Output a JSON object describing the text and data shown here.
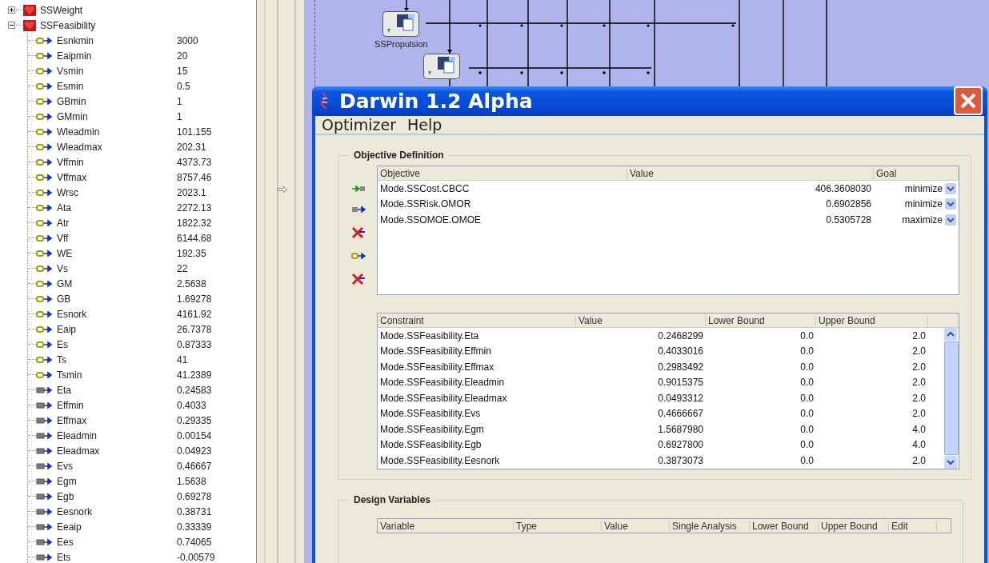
{
  "tree": [
    {
      "label": "SSWeight",
      "expanded": false
    },
    {
      "label": "SSFeasibility",
      "expanded": true,
      "children": [
        {
          "kind": "input",
          "name": "Esnkmin",
          "value": "3000"
        },
        {
          "kind": "input",
          "name": "Eaipmin",
          "value": "20"
        },
        {
          "kind": "input",
          "name": "Vsmin",
          "value": "15"
        },
        {
          "kind": "input",
          "name": "Esmin",
          "value": "0.5"
        },
        {
          "kind": "input",
          "name": "GBmin",
          "value": "1"
        },
        {
          "kind": "input",
          "name": "GMmin",
          "value": "1"
        },
        {
          "kind": "input",
          "name": "Wleadmin",
          "value": "101.155"
        },
        {
          "kind": "input",
          "name": "Wleadmax",
          "value": "202.31"
        },
        {
          "kind": "input",
          "name": "Vffmin",
          "value": "4373.73"
        },
        {
          "kind": "input",
          "name": "Vffmax",
          "value": "8757.46"
        },
        {
          "kind": "input",
          "name": "Wrsc",
          "value": "2023.1"
        },
        {
          "kind": "input",
          "name": "Ata",
          "value": "2272.13"
        },
        {
          "kind": "input",
          "name": "Atr",
          "value": "1822.32"
        },
        {
          "kind": "input",
          "name": "Vff",
          "value": "6144.68"
        },
        {
          "kind": "input",
          "name": "WE",
          "value": "192.35"
        },
        {
          "kind": "input",
          "name": "Vs",
          "value": "22"
        },
        {
          "kind": "input",
          "name": "GM",
          "value": "2.5638"
        },
        {
          "kind": "input",
          "name": "GB",
          "value": "1.69278"
        },
        {
          "kind": "input",
          "name": "Esnork",
          "value": "4161.92"
        },
        {
          "kind": "input",
          "name": "Eaip",
          "value": "26.7378"
        },
        {
          "kind": "input",
          "name": "Es",
          "value": "0.87333"
        },
        {
          "kind": "input",
          "name": "Ts",
          "value": "41"
        },
        {
          "kind": "input",
          "name": "Tsmin",
          "value": "41.2389"
        },
        {
          "kind": "output",
          "name": "Eta",
          "value": "0.24583"
        },
        {
          "kind": "output",
          "name": "Effmin",
          "value": "0.4033"
        },
        {
          "kind": "output",
          "name": "Effmax",
          "value": "0.29335"
        },
        {
          "kind": "output",
          "name": "Eleadmin",
          "value": "0.00154"
        },
        {
          "kind": "output",
          "name": "Eleadmax",
          "value": "0.04923"
        },
        {
          "kind": "output",
          "name": "Evs",
          "value": "0.46667"
        },
        {
          "kind": "output",
          "name": "Egm",
          "value": "1.5638"
        },
        {
          "kind": "output",
          "name": "Egb",
          "value": "0.69278"
        },
        {
          "kind": "output",
          "name": "Eesnork",
          "value": "0.38731"
        },
        {
          "kind": "output",
          "name": "Eeaip",
          "value": "0.33339"
        },
        {
          "kind": "output",
          "name": "Ees",
          "value": "0.74065"
        },
        {
          "kind": "output",
          "name": "Ets",
          "value": "-0.00579"
        }
      ]
    }
  ],
  "canvas": {
    "nodes": [
      {
        "kind": "component",
        "label": "SSPropulsion"
      },
      {
        "kind": "component"
      }
    ]
  },
  "dialog": {
    "title": "Darwin 1.2 Alpha",
    "menu": [
      "Optimizer",
      "Help"
    ],
    "objective_definition": {
      "title": "Objective Definition",
      "columns": [
        "Objective",
        "Value",
        "Goal"
      ],
      "rows": [
        {
          "objective": "Mode.SSCost.CBCC",
          "value": "406.3608030",
          "goal": "minimize"
        },
        {
          "objective": "Mode.SSRisk.OMOR",
          "value": "0.6902856",
          "goal": "minimize"
        },
        {
          "objective": "Mode.SSOMOE.OMOE",
          "value": "0.5305728",
          "goal": "maximize"
        }
      ],
      "constraint_columns": [
        "Constraint",
        "Value",
        "Lower Bound",
        "Upper Bound"
      ],
      "constraints": [
        {
          "name": "Mode.SSFeasibility.Eta",
          "value": "0.2468299",
          "lower": "0.0",
          "upper": "2.0"
        },
        {
          "name": "Mode.SSFeasibility.Effmin",
          "value": "0.4033016",
          "lower": "0.0",
          "upper": "2.0"
        },
        {
          "name": "Mode.SSFeasibility.Effmax",
          "value": "0.2983492",
          "lower": "0.0",
          "upper": "2.0"
        },
        {
          "name": "Mode.SSFeasibility.Eleadmin",
          "value": "0.9015375",
          "lower": "0.0",
          "upper": "2.0"
        },
        {
          "name": "Mode.SSFeasibility.Eleadmax",
          "value": "0.0493312",
          "lower": "0.0",
          "upper": "2.0"
        },
        {
          "name": "Mode.SSFeasibility.Evs",
          "value": "0.4666667",
          "lower": "0.0",
          "upper": "2.0"
        },
        {
          "name": "Mode.SSFeasibility.Egm",
          "value": "1.5687980",
          "lower": "0.0",
          "upper": "4.0"
        },
        {
          "name": "Mode.SSFeasibility.Egb",
          "value": "0.6927800",
          "lower": "0.0",
          "upper": "4.0"
        },
        {
          "name": "Mode.SSFeasibility.Eesnork",
          "value": "0.3873073",
          "lower": "0.0",
          "upper": "2.0"
        }
      ]
    },
    "design_variables": {
      "title": "Design Variables",
      "columns": [
        "Variable",
        "Type",
        "Value",
        "Single Analysis",
        "Lower Bound",
        "Upper Bound",
        "Edit"
      ]
    }
  }
}
